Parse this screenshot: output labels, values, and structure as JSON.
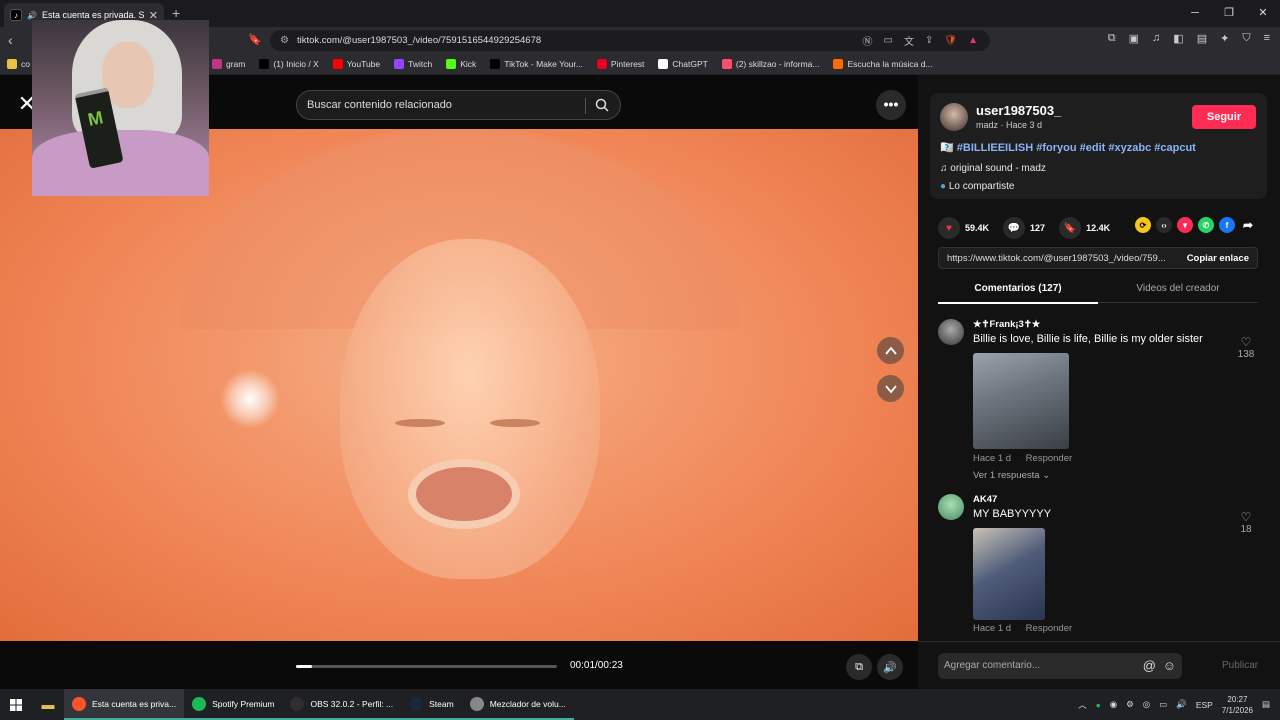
{
  "browser": {
    "tab_title": "Esta cuenta es privada. Sigue",
    "url": "tiktok.com/@user1987503_/video/7591516544929254678",
    "bookmarks": [
      {
        "label": "co",
        "icon": "folder-icon",
        "color": "#e8c04a"
      },
      {
        "label": "gram",
        "icon": "instagram-icon",
        "color": "#c13584"
      },
      {
        "label": "(1) Inicio / X",
        "icon": "x-icon",
        "color": "#000000"
      },
      {
        "label": "YouTube",
        "icon": "youtube-icon",
        "color": "#ff0000"
      },
      {
        "label": "Twitch",
        "icon": "twitch-icon",
        "color": "#9146ff"
      },
      {
        "label": "Kick",
        "icon": "kick-icon",
        "color": "#53fc18"
      },
      {
        "label": "TikTok - Make Your...",
        "icon": "tiktok-icon",
        "color": "#000000"
      },
      {
        "label": "Pinterest",
        "icon": "pinterest-icon",
        "color": "#e60023"
      },
      {
        "label": "ChatGPT",
        "icon": "chatgpt-icon",
        "color": "#ffffff"
      },
      {
        "label": "(2) skillzao - informa...",
        "icon": "site-icon",
        "color": "#ff4d6d"
      },
      {
        "label": "Escucha la música d...",
        "icon": "music-site-icon",
        "color": "#ff6a00"
      }
    ]
  },
  "video": {
    "search_placeholder": "Buscar contenido relacionado",
    "time": "00:01/00:23",
    "progress": 0.06
  },
  "post": {
    "username": "user1987503_",
    "subline": "madz · Hace 3 d",
    "follow_label": "Seguir",
    "caption_prefix": "🇽🇽",
    "hashtags": [
      "#BILLIEEILISH",
      "#foryou",
      "#edit",
      "#xyzabc",
      "#capcut"
    ],
    "sound": "original sound - madz",
    "shared": "Lo compartiste",
    "likes": "59.4K",
    "comments": "127",
    "saves": "12.4K",
    "link": "https://www.tiktok.com/@user1987503_/video/759...",
    "copy_label": "Copiar enlace",
    "tab_comments": "Comentarios (127)",
    "tab_creator": "Videos del creador"
  },
  "comments": [
    {
      "name": "★✝Frank¡3✝★",
      "text": "Billie is love, Billie is life, Billie is my older sister",
      "time": "Hace 1 d",
      "reply_label": "Responder",
      "likes": "138",
      "replies": "Ver 1 respuesta"
    },
    {
      "name": "AK47",
      "text": "MY BABYYYYY",
      "time": "Hace 1 d",
      "reply_label": "Responder",
      "likes": "18"
    }
  ],
  "comment_input": {
    "placeholder": "Agregar comentario...",
    "publish": "Publicar"
  },
  "taskbar": {
    "items": [
      {
        "label": "Esta cuenta es priva...",
        "icon": "brave-icon",
        "color": "#fb542b"
      },
      {
        "label": "Spotify Premium",
        "icon": "spotify-icon",
        "color": "#1db954"
      },
      {
        "label": "OBS 32.0.2 - Perfil: ...",
        "icon": "obs-icon",
        "color": "#302e31"
      },
      {
        "label": "Steam",
        "icon": "steam-icon",
        "color": "#1b2838"
      },
      {
        "label": "Mezclador de volu...",
        "icon": "volume-mixer-icon",
        "color": "#888888"
      }
    ],
    "lang": "ESP",
    "time": "20:27",
    "date": "7/1/2026"
  }
}
